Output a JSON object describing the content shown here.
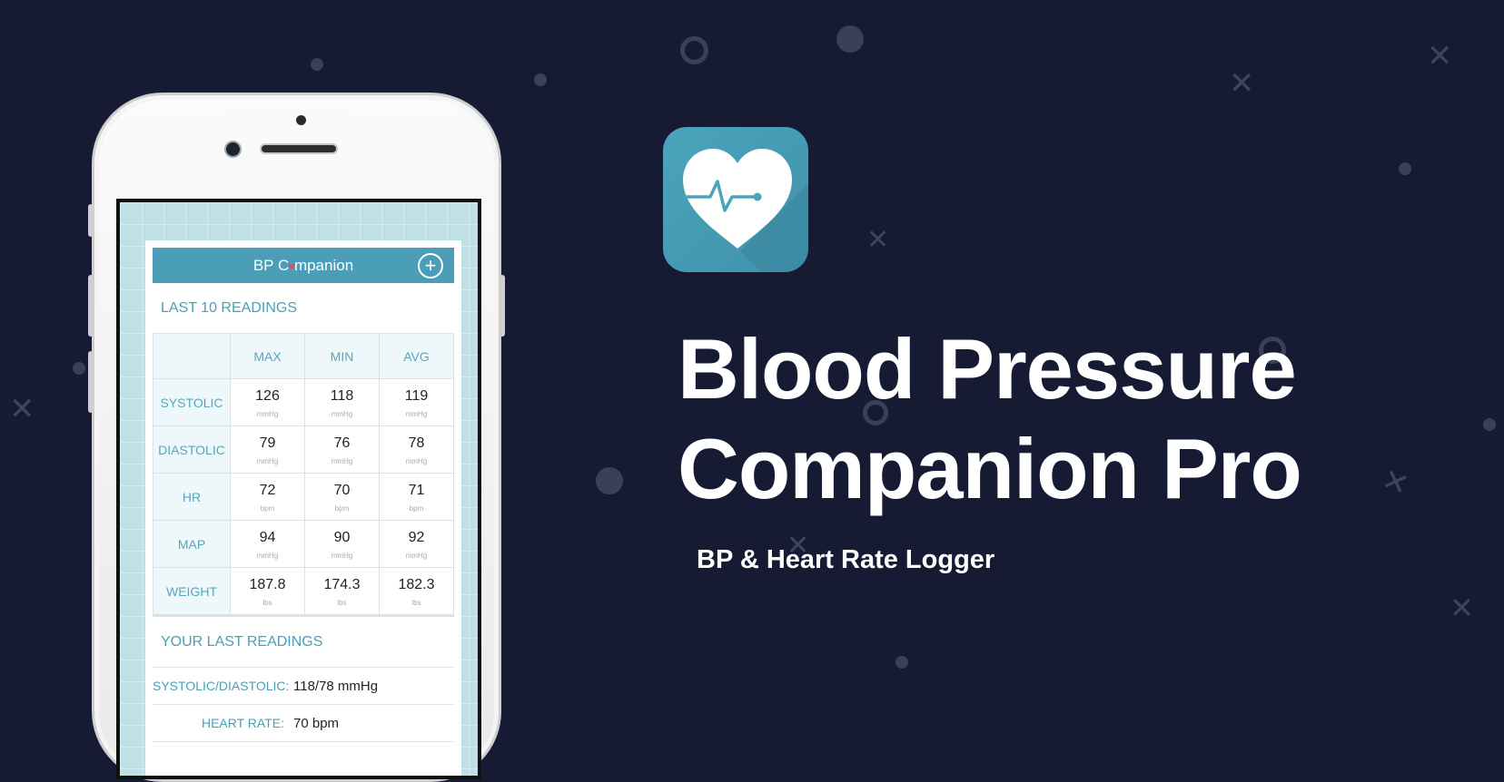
{
  "app": {
    "title_line1": "Blood Pressure",
    "title_line2": "Companion Pro",
    "subtitle": "BP & Heart Rate Logger",
    "icon_name": "heart-pulse-icon",
    "colors": {
      "background": "#161b33",
      "icon": "#4ba3bc",
      "accent": "#4a9fb8",
      "heart": "#e74a54"
    }
  },
  "screen": {
    "header_prefix": "BP C",
    "header_suffix": "mpanion",
    "header_heart": "♥",
    "add_icon": "+",
    "last10_title": "LAST 10 READINGS",
    "columns": [
      "MAX",
      "MIN",
      "AVG"
    ],
    "rows": [
      {
        "label": "SYSTOLIC",
        "values": [
          "126",
          "118",
          "119"
        ],
        "unit": "mmHg"
      },
      {
        "label": "DIASTOLIC",
        "values": [
          "79",
          "76",
          "78"
        ],
        "unit": "mmHg"
      },
      {
        "label": "HR",
        "values": [
          "72",
          "70",
          "71"
        ],
        "unit": "bpm"
      },
      {
        "label": "MAP",
        "values": [
          "94",
          "90",
          "92"
        ],
        "unit": "mmHg"
      },
      {
        "label": "WEIGHT",
        "values": [
          "187.8",
          "174.3",
          "182.3"
        ],
        "unit": "lbs"
      }
    ],
    "your_last_title": "YOUR LAST READINGS",
    "readings": [
      {
        "label": "SYSTOLIC/DIASTOLIC:",
        "value": "118/78 mmHg"
      },
      {
        "label": "HEART RATE:",
        "value": "70 bpm"
      }
    ]
  }
}
